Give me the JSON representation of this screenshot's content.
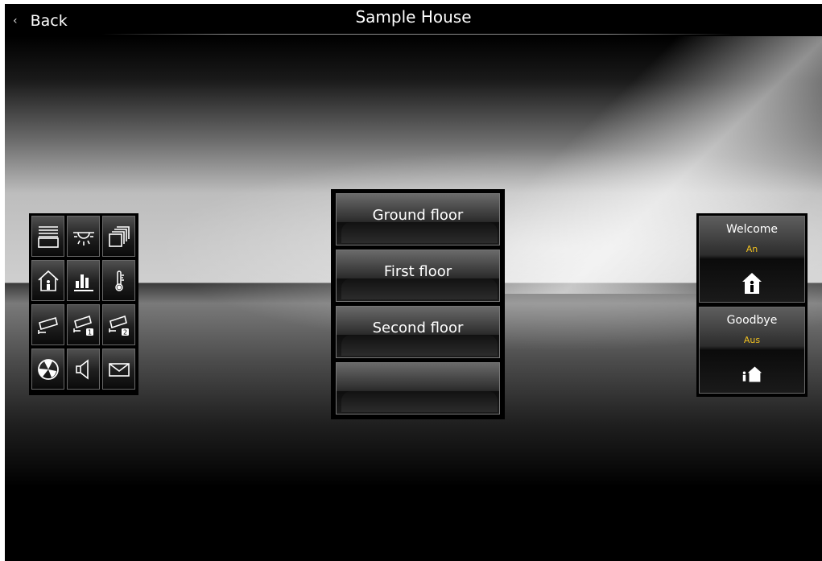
{
  "header": {
    "back_label": "Back",
    "title": "Sample House"
  },
  "icon_grid": [
    {
      "name": "blinds-icon"
    },
    {
      "name": "light-icon"
    },
    {
      "name": "pages-icon"
    },
    {
      "name": "house-person-icon"
    },
    {
      "name": "bar-chart-icon"
    },
    {
      "name": "thermometer-icon"
    },
    {
      "name": "camera-icon"
    },
    {
      "name": "camera-1-icon"
    },
    {
      "name": "camera-2-icon"
    },
    {
      "name": "fan-icon"
    },
    {
      "name": "speaker-icon"
    },
    {
      "name": "mail-icon"
    }
  ],
  "floors": [
    {
      "label": "Ground floor"
    },
    {
      "label": "First floor"
    },
    {
      "label": "Second floor"
    },
    {
      "label": ""
    }
  ],
  "scenes": [
    {
      "label": "Welcome",
      "state": "An",
      "icon": "person-in-house-icon"
    },
    {
      "label": "Goodbye",
      "state": "Aus",
      "icon": "person-leaving-house-icon"
    }
  ],
  "colors": {
    "state_text": "#f0c020",
    "button_border": "#777777"
  }
}
